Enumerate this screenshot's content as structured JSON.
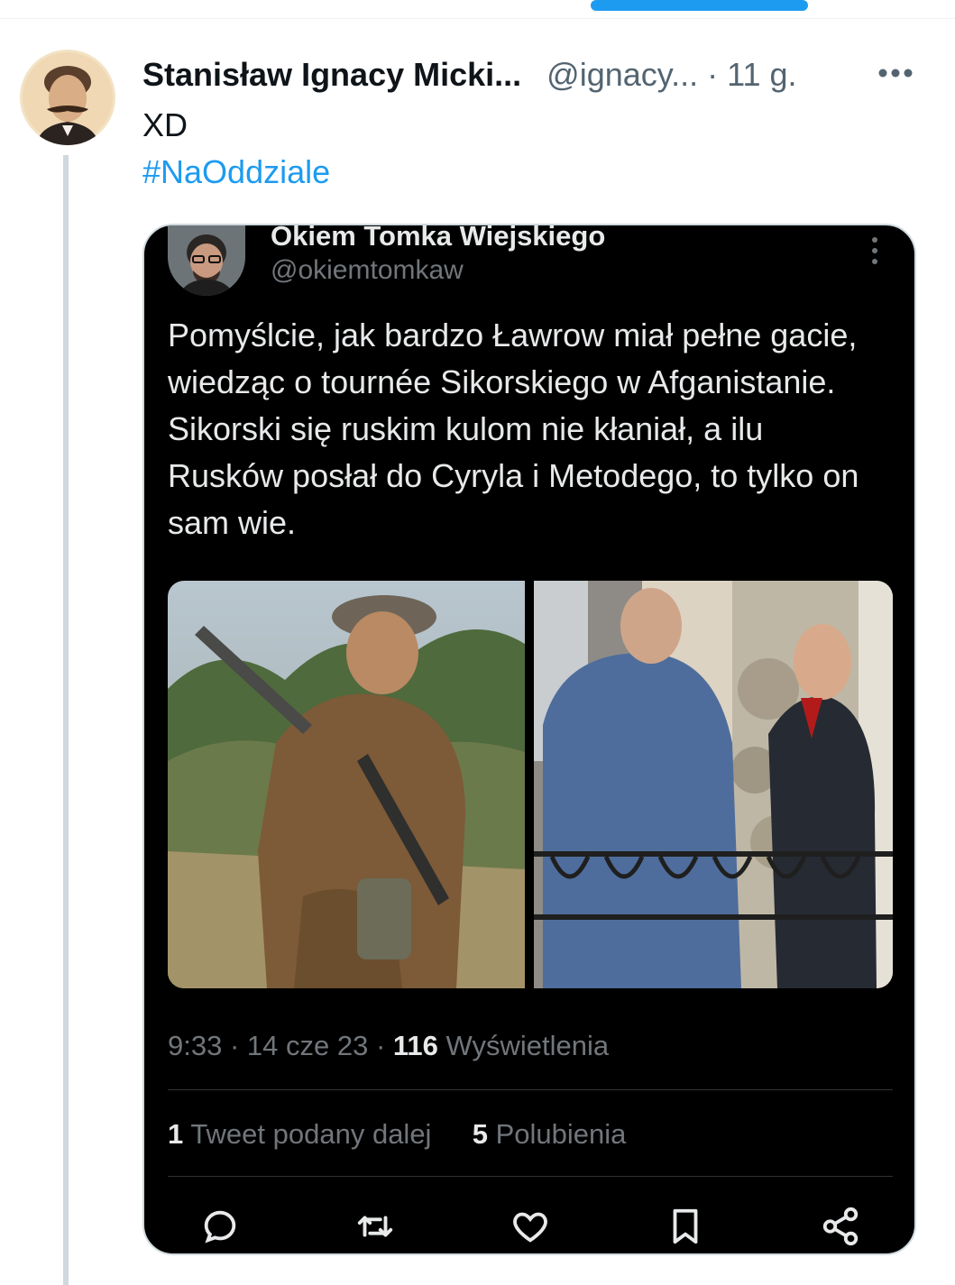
{
  "post": {
    "author_name": "Stanisław Ignacy Micki...",
    "handle": "@ignacy...",
    "separator": "·",
    "time_ago": "11 g.",
    "text": "XD",
    "hashtag": "#NaOddziale"
  },
  "embedded_tweet": {
    "author_name": "Okiem Tomka Wiejskiego",
    "handle": "@okiemtomkaw",
    "text": "Pomyślcie, jak bardzo Ławrow miał pełne gacie, wiedząc o tournée Sikorskiego w Afganistanie. Sikorski się ruskim kulom nie kłaniał, a ilu Rusków posłał do Cyryla i Metodego, to tylko on sam wie.",
    "time": "9:33",
    "date": "14 cze 23",
    "views_count": "116",
    "views_label": "Wyświetlenia",
    "retweets_count": "1",
    "retweets_label": "Tweet podany dalej",
    "likes_count": "5",
    "likes_label": "Polubienia"
  },
  "icons": {
    "more": "more-horizontal-icon",
    "reply": "reply-icon",
    "retweet": "retweet-icon",
    "like": "heart-icon",
    "bookmark": "bookmark-icon",
    "share": "share-icon"
  },
  "colors": {
    "accent": "#1d9bf0",
    "embed_bg": "#000000",
    "muted": "#536471"
  }
}
